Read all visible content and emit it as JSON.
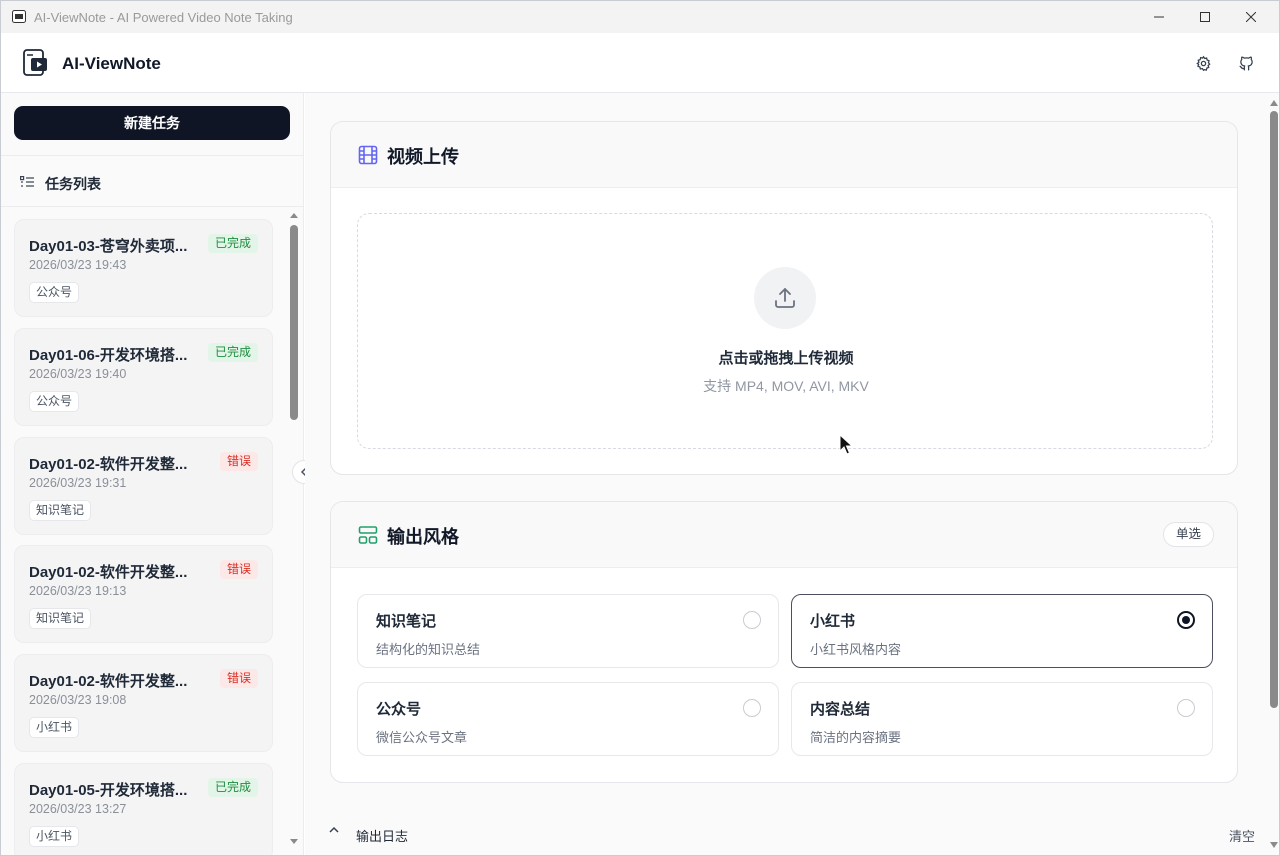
{
  "window": {
    "title": "AI-ViewNote - AI Powered Video Note Taking",
    "controls": [
      "minimize",
      "maximize",
      "close"
    ]
  },
  "header": {
    "app_name": "AI-ViewNote",
    "icons": [
      "settings-icon",
      "github-icon"
    ]
  },
  "sidebar": {
    "new_task_label": "新建任务",
    "list_title": "任务列表",
    "tasks": [
      {
        "title": "Day01-03-苍穹外卖项...",
        "date": "2026/03/23 19:43",
        "tag": "公众号",
        "status": "已完成",
        "status_kind": "done"
      },
      {
        "title": "Day01-06-开发环境搭...",
        "date": "2026/03/23 19:40",
        "tag": "公众号",
        "status": "已完成",
        "status_kind": "done"
      },
      {
        "title": "Day01-02-软件开发整...",
        "date": "2026/03/23 19:31",
        "tag": "知识笔记",
        "status": "错误",
        "status_kind": "err"
      },
      {
        "title": "Day01-02-软件开发整...",
        "date": "2026/03/23 19:13",
        "tag": "知识笔记",
        "status": "错误",
        "status_kind": "err"
      },
      {
        "title": "Day01-02-软件开发整...",
        "date": "2026/03/23 19:08",
        "tag": "小红书",
        "status": "错误",
        "status_kind": "err"
      },
      {
        "title": "Day01-05-开发环境搭...",
        "date": "2026/03/23 13:27",
        "tag": "小红书",
        "status": "已完成",
        "status_kind": "done"
      }
    ]
  },
  "upload": {
    "title": "视频上传",
    "main_text": "点击或拖拽上传视频",
    "sub_text": "支持 MP4, MOV, AVI, MKV"
  },
  "style": {
    "title": "输出风格",
    "mode_label": "单选",
    "options": [
      {
        "name": "知识笔记",
        "desc": "结构化的知识总结",
        "selected": false
      },
      {
        "name": "小红书",
        "desc": "小红书风格内容",
        "selected": true
      },
      {
        "name": "公众号",
        "desc": "微信公众号文章",
        "selected": false
      },
      {
        "name": "内容总结",
        "desc": "简洁的内容摘要",
        "selected": false
      }
    ]
  },
  "log": {
    "label": "输出日志",
    "clear_label": "清空"
  },
  "colors": {
    "primary": "#0f1525",
    "done_text": "#1e8e3e",
    "done_bg": "#e3f5e8",
    "error_text": "#d93025",
    "error_bg": "#fde8e8",
    "upload_icon": "#6366f1",
    "style_icon": "#22a06b"
  }
}
